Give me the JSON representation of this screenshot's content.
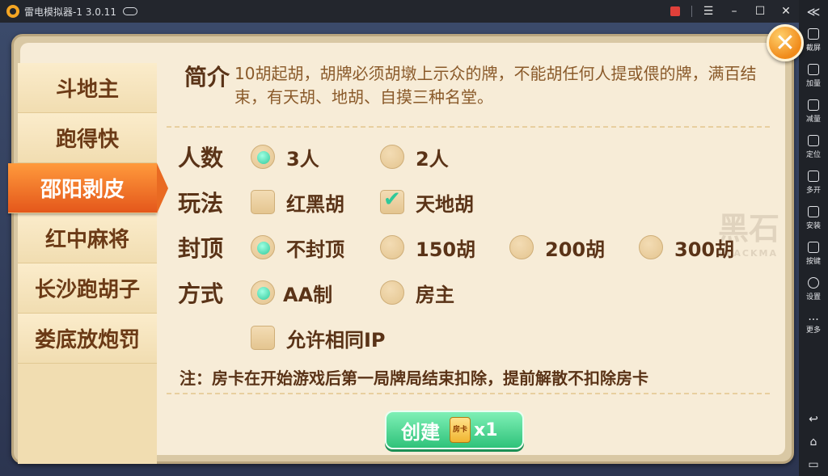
{
  "window": {
    "title": "雷电模拟器-1 3.0.11"
  },
  "emulator_sidebar": {
    "collapse_label": "≪",
    "items": [
      {
        "label": "截屏",
        "icon": "scissors-icon"
      },
      {
        "label": "加量",
        "icon": "volume-up-icon"
      },
      {
        "label": "减量",
        "icon": "volume-down-icon"
      },
      {
        "label": "定位",
        "icon": "location-icon"
      },
      {
        "label": "多开",
        "icon": "multi-window-icon"
      },
      {
        "label": "安装",
        "icon": "apk-install-icon"
      },
      {
        "label": "按键",
        "icon": "keyboard-icon"
      },
      {
        "label": "设置",
        "icon": "gear-icon"
      },
      {
        "label": "更多",
        "icon": "more-icon"
      }
    ]
  },
  "game_tabs": [
    {
      "label": "斗地主",
      "active": false
    },
    {
      "label": "跑得快",
      "active": false
    },
    {
      "label": "邵阳剥皮",
      "active": true
    },
    {
      "label": "红中麻将",
      "active": false
    },
    {
      "label": "长沙跑胡子",
      "active": false
    },
    {
      "label": "娄底放炮罚",
      "active": false
    }
  ],
  "intro": {
    "label": "简介",
    "text": "10胡起胡，胡牌必须胡墩上示众的牌，不能胡任何人提或偎的牌，满百结束，有天胡、地胡、自摸三种名堂。"
  },
  "settings": {
    "players": {
      "label": "人数",
      "options": [
        {
          "label": "3人",
          "selected": true
        },
        {
          "label": "2人",
          "selected": false
        }
      ]
    },
    "play": {
      "label": "玩法",
      "options": [
        {
          "label": "红黑胡",
          "checked": false
        },
        {
          "label": "天地胡",
          "checked": true
        }
      ]
    },
    "cap": {
      "label": "封顶",
      "options": [
        {
          "label": "不封顶",
          "selected": true
        },
        {
          "label": "150胡",
          "selected": false
        },
        {
          "label": "200胡",
          "selected": false
        },
        {
          "label": "300胡",
          "selected": false
        }
      ]
    },
    "payment": {
      "label": "方式",
      "options": [
        {
          "label": "AA制",
          "selected": true
        },
        {
          "label": "房主",
          "selected": false
        }
      ]
    },
    "same_ip": {
      "label": "允许相同IP",
      "checked": false
    }
  },
  "note": "注：房卡在开始游戏后第一局牌局结束扣除，提前解散不扣除房卡",
  "create_button": {
    "label": "创建",
    "card_text": "房卡",
    "quantity": "x1"
  },
  "watermark": {
    "text": "黑石",
    "sub": "BLACKMA"
  }
}
